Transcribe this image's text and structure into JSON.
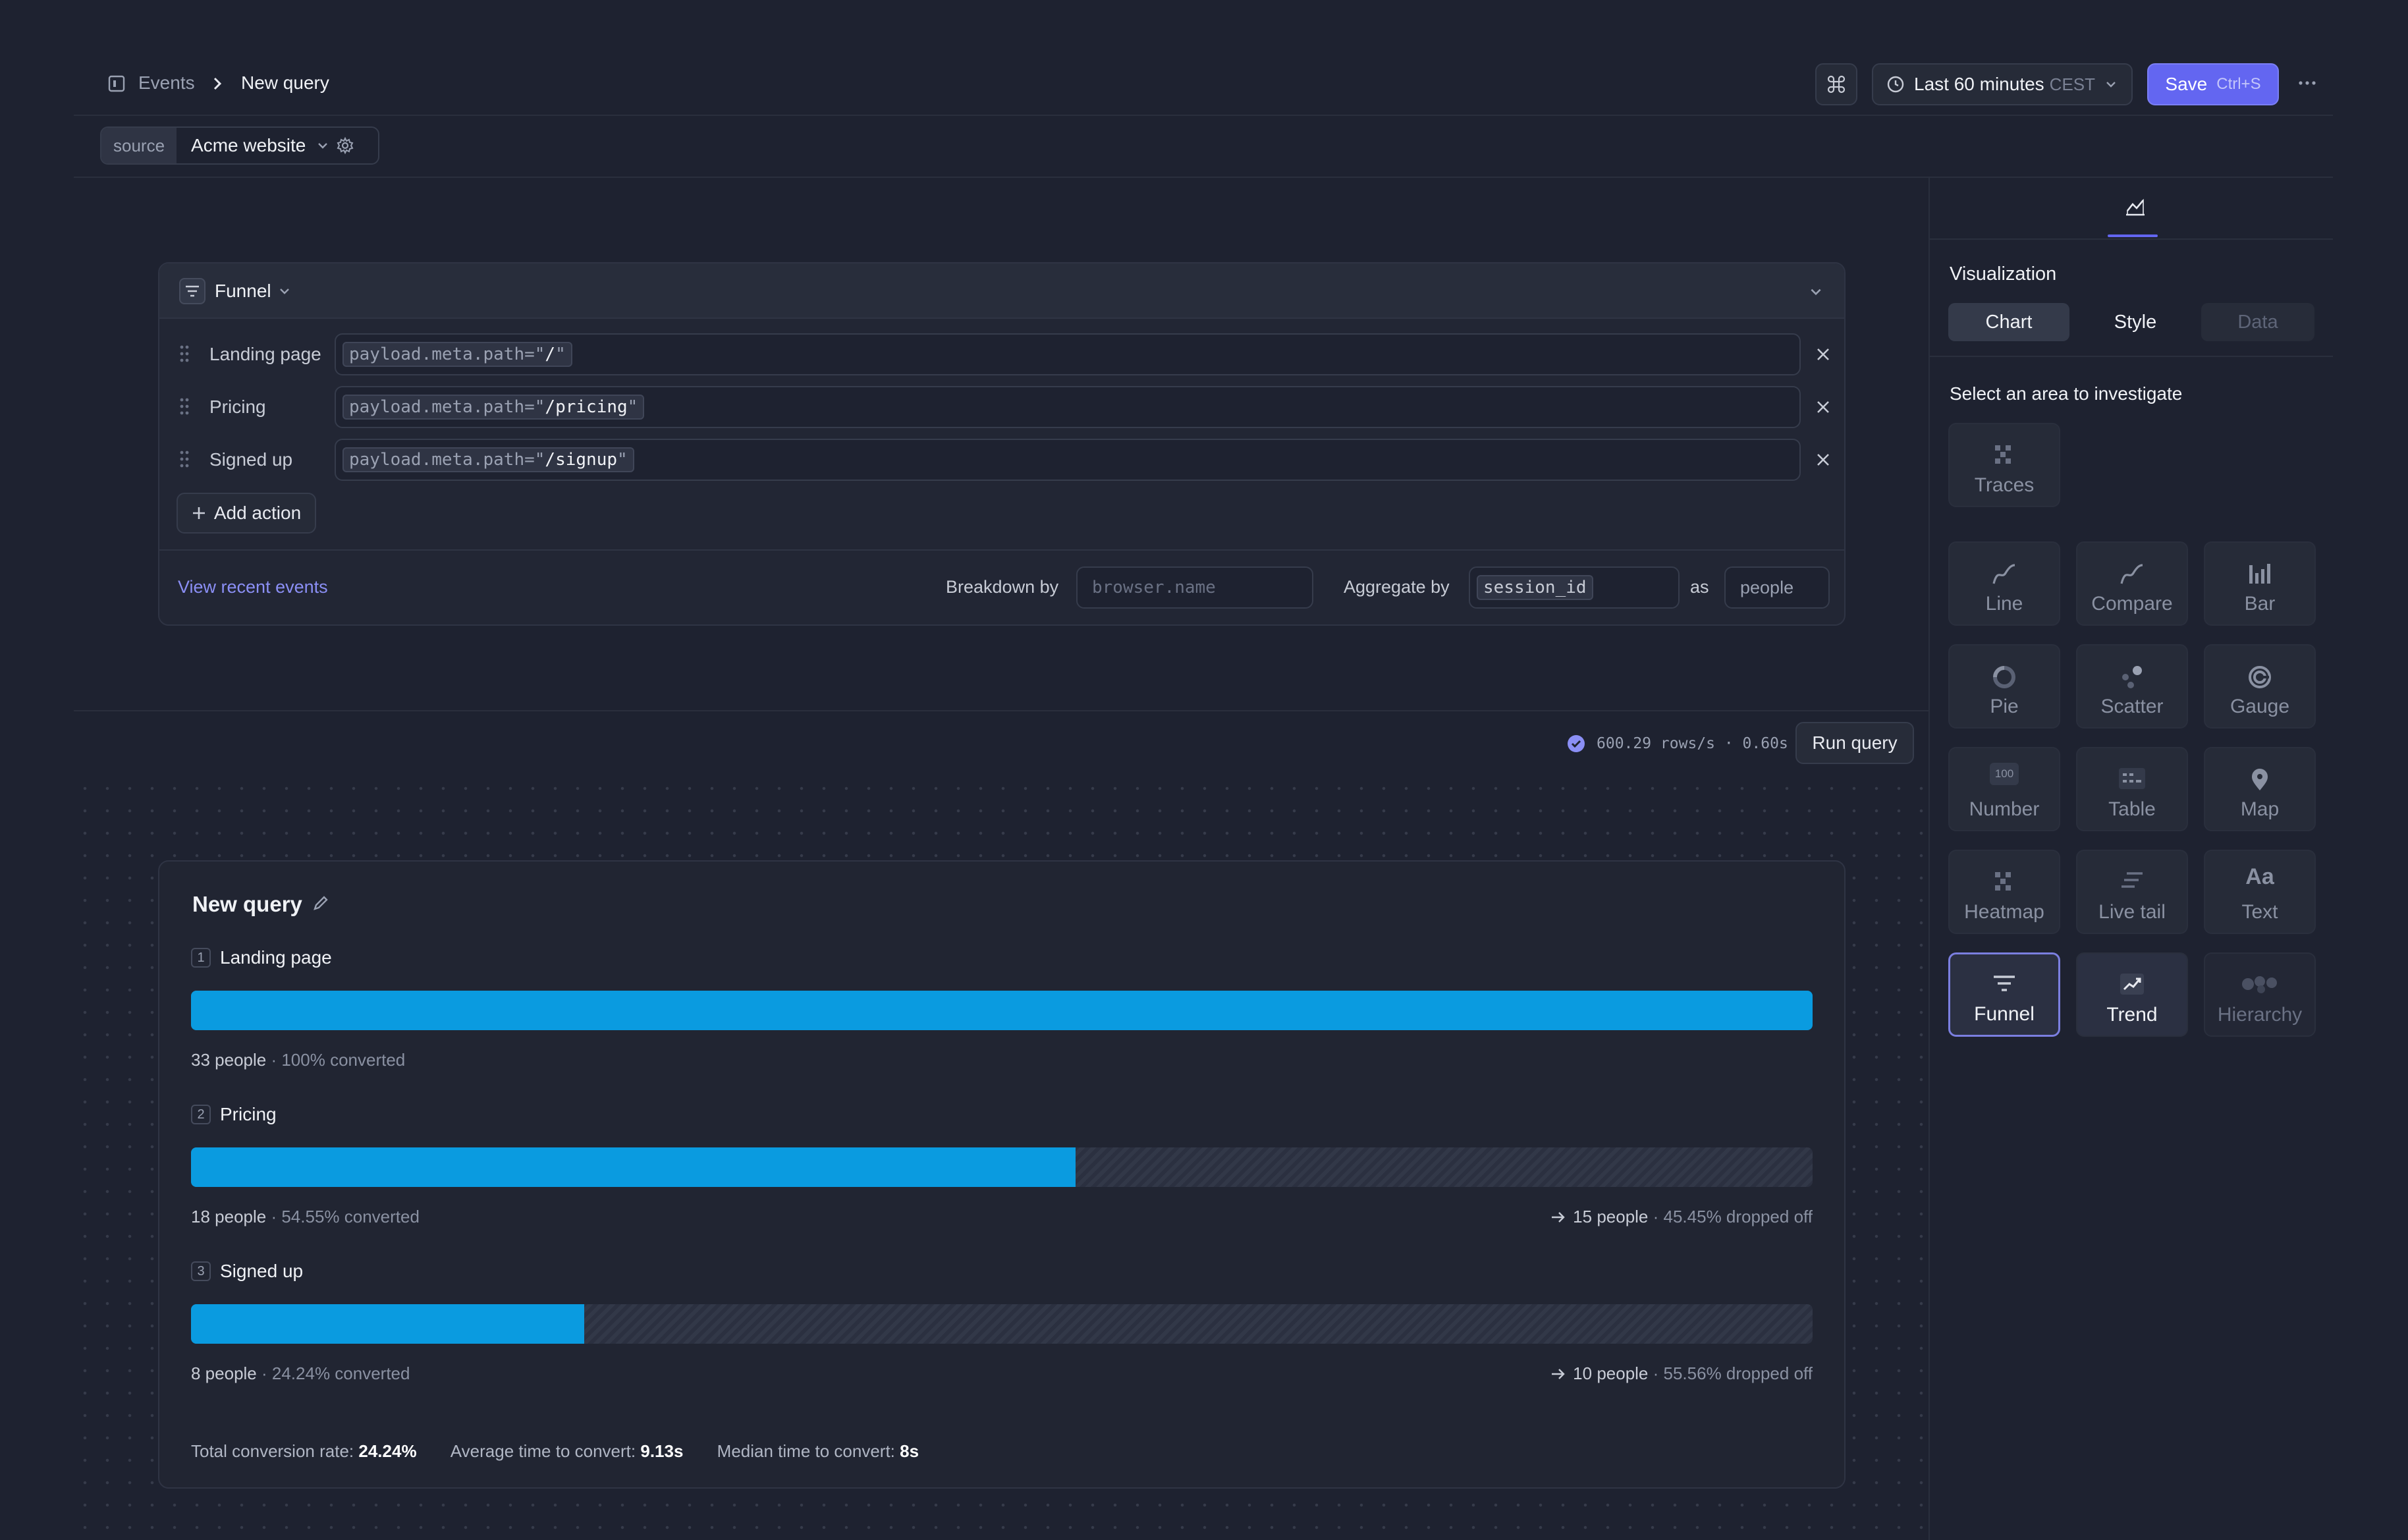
{
  "header": {
    "breadcrumb_root": "Events",
    "breadcrumb_current": "New query",
    "time_range": "Last 60 minutes",
    "timezone": "CEST",
    "save_label": "Save",
    "save_shortcut": "Ctrl+S"
  },
  "source": {
    "label": "source",
    "value": "Acme website"
  },
  "query": {
    "type_label": "Funnel",
    "steps": [
      {
        "name": "Landing page",
        "filter_key": "payload.meta.path=\"",
        "filter_val": "/",
        "filter_end": "\""
      },
      {
        "name": "Pricing",
        "filter_key": "payload.meta.path=\"",
        "filter_val": "/pricing",
        "filter_end": "\""
      },
      {
        "name": "Signed up",
        "filter_key": "payload.meta.path=\"",
        "filter_val": "/signup",
        "filter_end": "\""
      }
    ],
    "add_action_label": "Add action",
    "view_recent_label": "View recent events",
    "breakdown_label": "Breakdown by",
    "breakdown_placeholder": "browser.name",
    "aggregate_label": "Aggregate by",
    "aggregate_value": "session_id",
    "as_label": "as",
    "as_value": "people"
  },
  "run": {
    "stats": "600.29 rows/s · 0.60s",
    "run_label": "Run query"
  },
  "result": {
    "title": "New query",
    "funnel": [
      {
        "num": "1",
        "name": "Landing page",
        "people": "33 people",
        "converted": "100% converted",
        "pct": 100,
        "dropped_people": "",
        "dropped_pct": ""
      },
      {
        "num": "2",
        "name": "Pricing",
        "people": "18 people",
        "converted": "54.55% converted",
        "pct": 54.55,
        "dropped_people": "15 people",
        "dropped_pct": "45.45% dropped off"
      },
      {
        "num": "3",
        "name": "Signed up",
        "people": "8 people",
        "converted": "24.24% converted",
        "pct": 24.24,
        "dropped_people": "10 people",
        "dropped_pct": "55.56% dropped off"
      }
    ],
    "total_label": "Total conversion rate:",
    "total_value": "24.24%",
    "avg_label": "Average time to convert:",
    "avg_value": "9.13s",
    "median_label": "Median time to convert:",
    "median_value": "8s"
  },
  "panel": {
    "section_title": "Visualization",
    "tabs": [
      "Chart",
      "Style",
      "Data"
    ],
    "investigate_label": "Select an area to investigate",
    "viz_types": [
      "Traces",
      "Line",
      "Compare",
      "Bar",
      "Pie",
      "Scatter",
      "Gauge",
      "Number",
      "Table",
      "Map",
      "Heatmap",
      "Live tail",
      "Text",
      "Funnel",
      "Trend",
      "Hierarchy"
    ],
    "number_icon_text": "100",
    "text_icon_text": "Aa"
  },
  "colors": {
    "accent": "#6366f1",
    "bar": "#0a9be0",
    "background": "#1e2230"
  }
}
